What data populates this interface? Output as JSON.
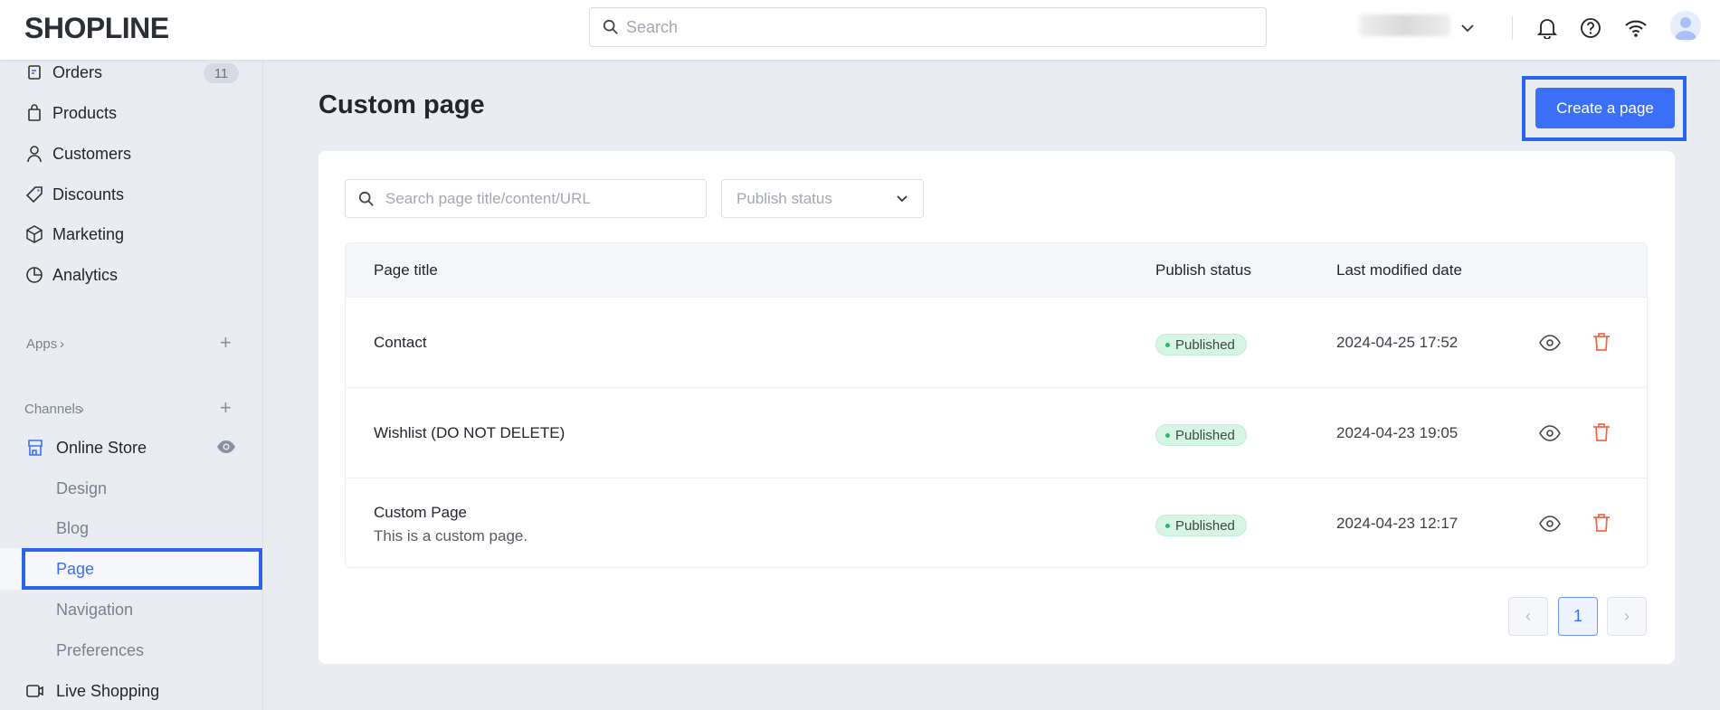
{
  "header": {
    "logo": "SHOPLINE",
    "search_placeholder": "Search"
  },
  "sidebar": {
    "items": [
      {
        "label": "Orders",
        "badge": "11"
      },
      {
        "label": "Products"
      },
      {
        "label": "Customers"
      },
      {
        "label": "Discounts"
      },
      {
        "label": "Marketing"
      },
      {
        "label": "Analytics"
      }
    ],
    "apps_label": "Apps",
    "channels_label": "Channels",
    "online_store": "Online Store",
    "sub_items": [
      "Design",
      "Blog",
      "Page",
      "Navigation",
      "Preferences"
    ],
    "live_shopping": "Live Shopping"
  },
  "main": {
    "title": "Custom page",
    "create_button": "Create a page",
    "search_placeholder": "Search page title/content/URL",
    "status_filter_placeholder": "Publish status",
    "columns": [
      "Page title",
      "Publish status",
      "Last modified date"
    ],
    "rows": [
      {
        "title": "Contact",
        "subtitle": "",
        "status": "Published",
        "date": "2024-04-25 17:52"
      },
      {
        "title": "Wishlist (DO NOT DELETE)",
        "subtitle": "",
        "status": "Published",
        "date": "2024-04-23 19:05"
      },
      {
        "title": "Custom Page",
        "subtitle": "This is a custom page.",
        "status": "Published",
        "date": "2024-04-23 12:17"
      }
    ],
    "pagination": {
      "current": "1"
    }
  },
  "colors": {
    "accent": "#3a6ff7",
    "delete": "#f0684a",
    "published_bg": "#d7f5e4"
  }
}
